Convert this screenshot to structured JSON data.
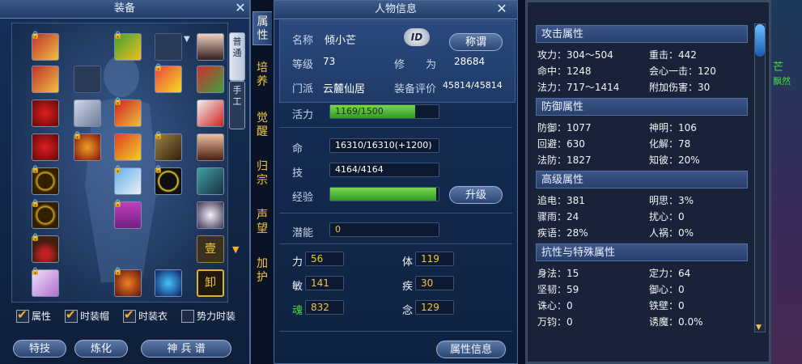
{
  "equip_panel": {
    "title": "装备",
    "side_tabs": [
      "普通",
      "手工"
    ],
    "rank_button": "壹",
    "unload_button": "卸",
    "checkboxes": [
      {
        "label": "属性",
        "checked": true
      },
      {
        "label": "时装帽",
        "checked": true
      },
      {
        "label": "时装衣",
        "checked": true
      },
      {
        "label": "势力时装",
        "checked": false
      }
    ],
    "buttons": [
      "特技",
      "炼化",
      "神 兵 谱"
    ]
  },
  "vertical_tabs": [
    "属性",
    "培养",
    "觉醒",
    "归宗",
    "声望",
    "加护"
  ],
  "char_panel": {
    "title": "人物信息",
    "name_label": "名称",
    "name": "倾小芒",
    "id_badge": "ID",
    "title_button": "称谓",
    "level_label": "等级",
    "level": "73",
    "cultivation_label": "修　　为",
    "cultivation": "28684",
    "sect_label": "门派",
    "sect": "云麓仙居",
    "rating_label": "装备评价",
    "rating": "45814/45814",
    "vitality_label": "活力",
    "vitality": "1169/1500",
    "vitality_ratio": 0.78,
    "hp_label": "命",
    "hp": "16310/16310(+1200)",
    "skill_label": "技",
    "skill": "4164/4164",
    "exp_label": "经验",
    "exp_ratio": 0.98,
    "upgrade_button": "升级",
    "potential_label": "潜能",
    "potential": "0",
    "stats": [
      {
        "label": "力",
        "value": "56"
      },
      {
        "label": "体",
        "value": "119"
      },
      {
        "label": "敏",
        "value": "141"
      },
      {
        "label": "疾",
        "value": "30"
      },
      {
        "label": "魂",
        "value": "832"
      },
      {
        "label": "念",
        "value": "129"
      }
    ],
    "attr_button": "属性信息"
  },
  "attr_panel": {
    "sections": [
      {
        "title": "攻击属性",
        "items": [
          [
            "攻力：304～504",
            "重击：442"
          ],
          [
            "命中：1248",
            "会心一击：120"
          ],
          [
            "法力：717～1414",
            "附加伤害：30"
          ]
        ]
      },
      {
        "title": "防御属性",
        "items": [
          [
            "防御：1077",
            "神明：106"
          ],
          [
            "回避：630",
            "化解：78"
          ],
          [
            "法防：1827",
            "知彼：20%"
          ]
        ]
      },
      {
        "title": "高级属性",
        "items": [
          [
            "追电：381",
            "明思：3%"
          ],
          [
            "骤雨：24",
            "扰心：0"
          ],
          [
            "疾语：28%",
            "人祸：0%"
          ]
        ]
      },
      {
        "title": "抗性与特殊属性",
        "items": [
          [
            "身法：15",
            "定力：64"
          ],
          [
            "坚韧：59",
            "御心：0"
          ],
          [
            "诛心：0",
            "铁壁：0"
          ],
          [
            "万钧：0",
            "诱魔：0.0%"
          ]
        ]
      }
    ]
  },
  "edge_text": [
    "芒",
    "飘然"
  ],
  "colors": {
    "accent_gold": "#f0c640",
    "bar_green": "#3fb82a",
    "panel_blue": "#17305a"
  }
}
